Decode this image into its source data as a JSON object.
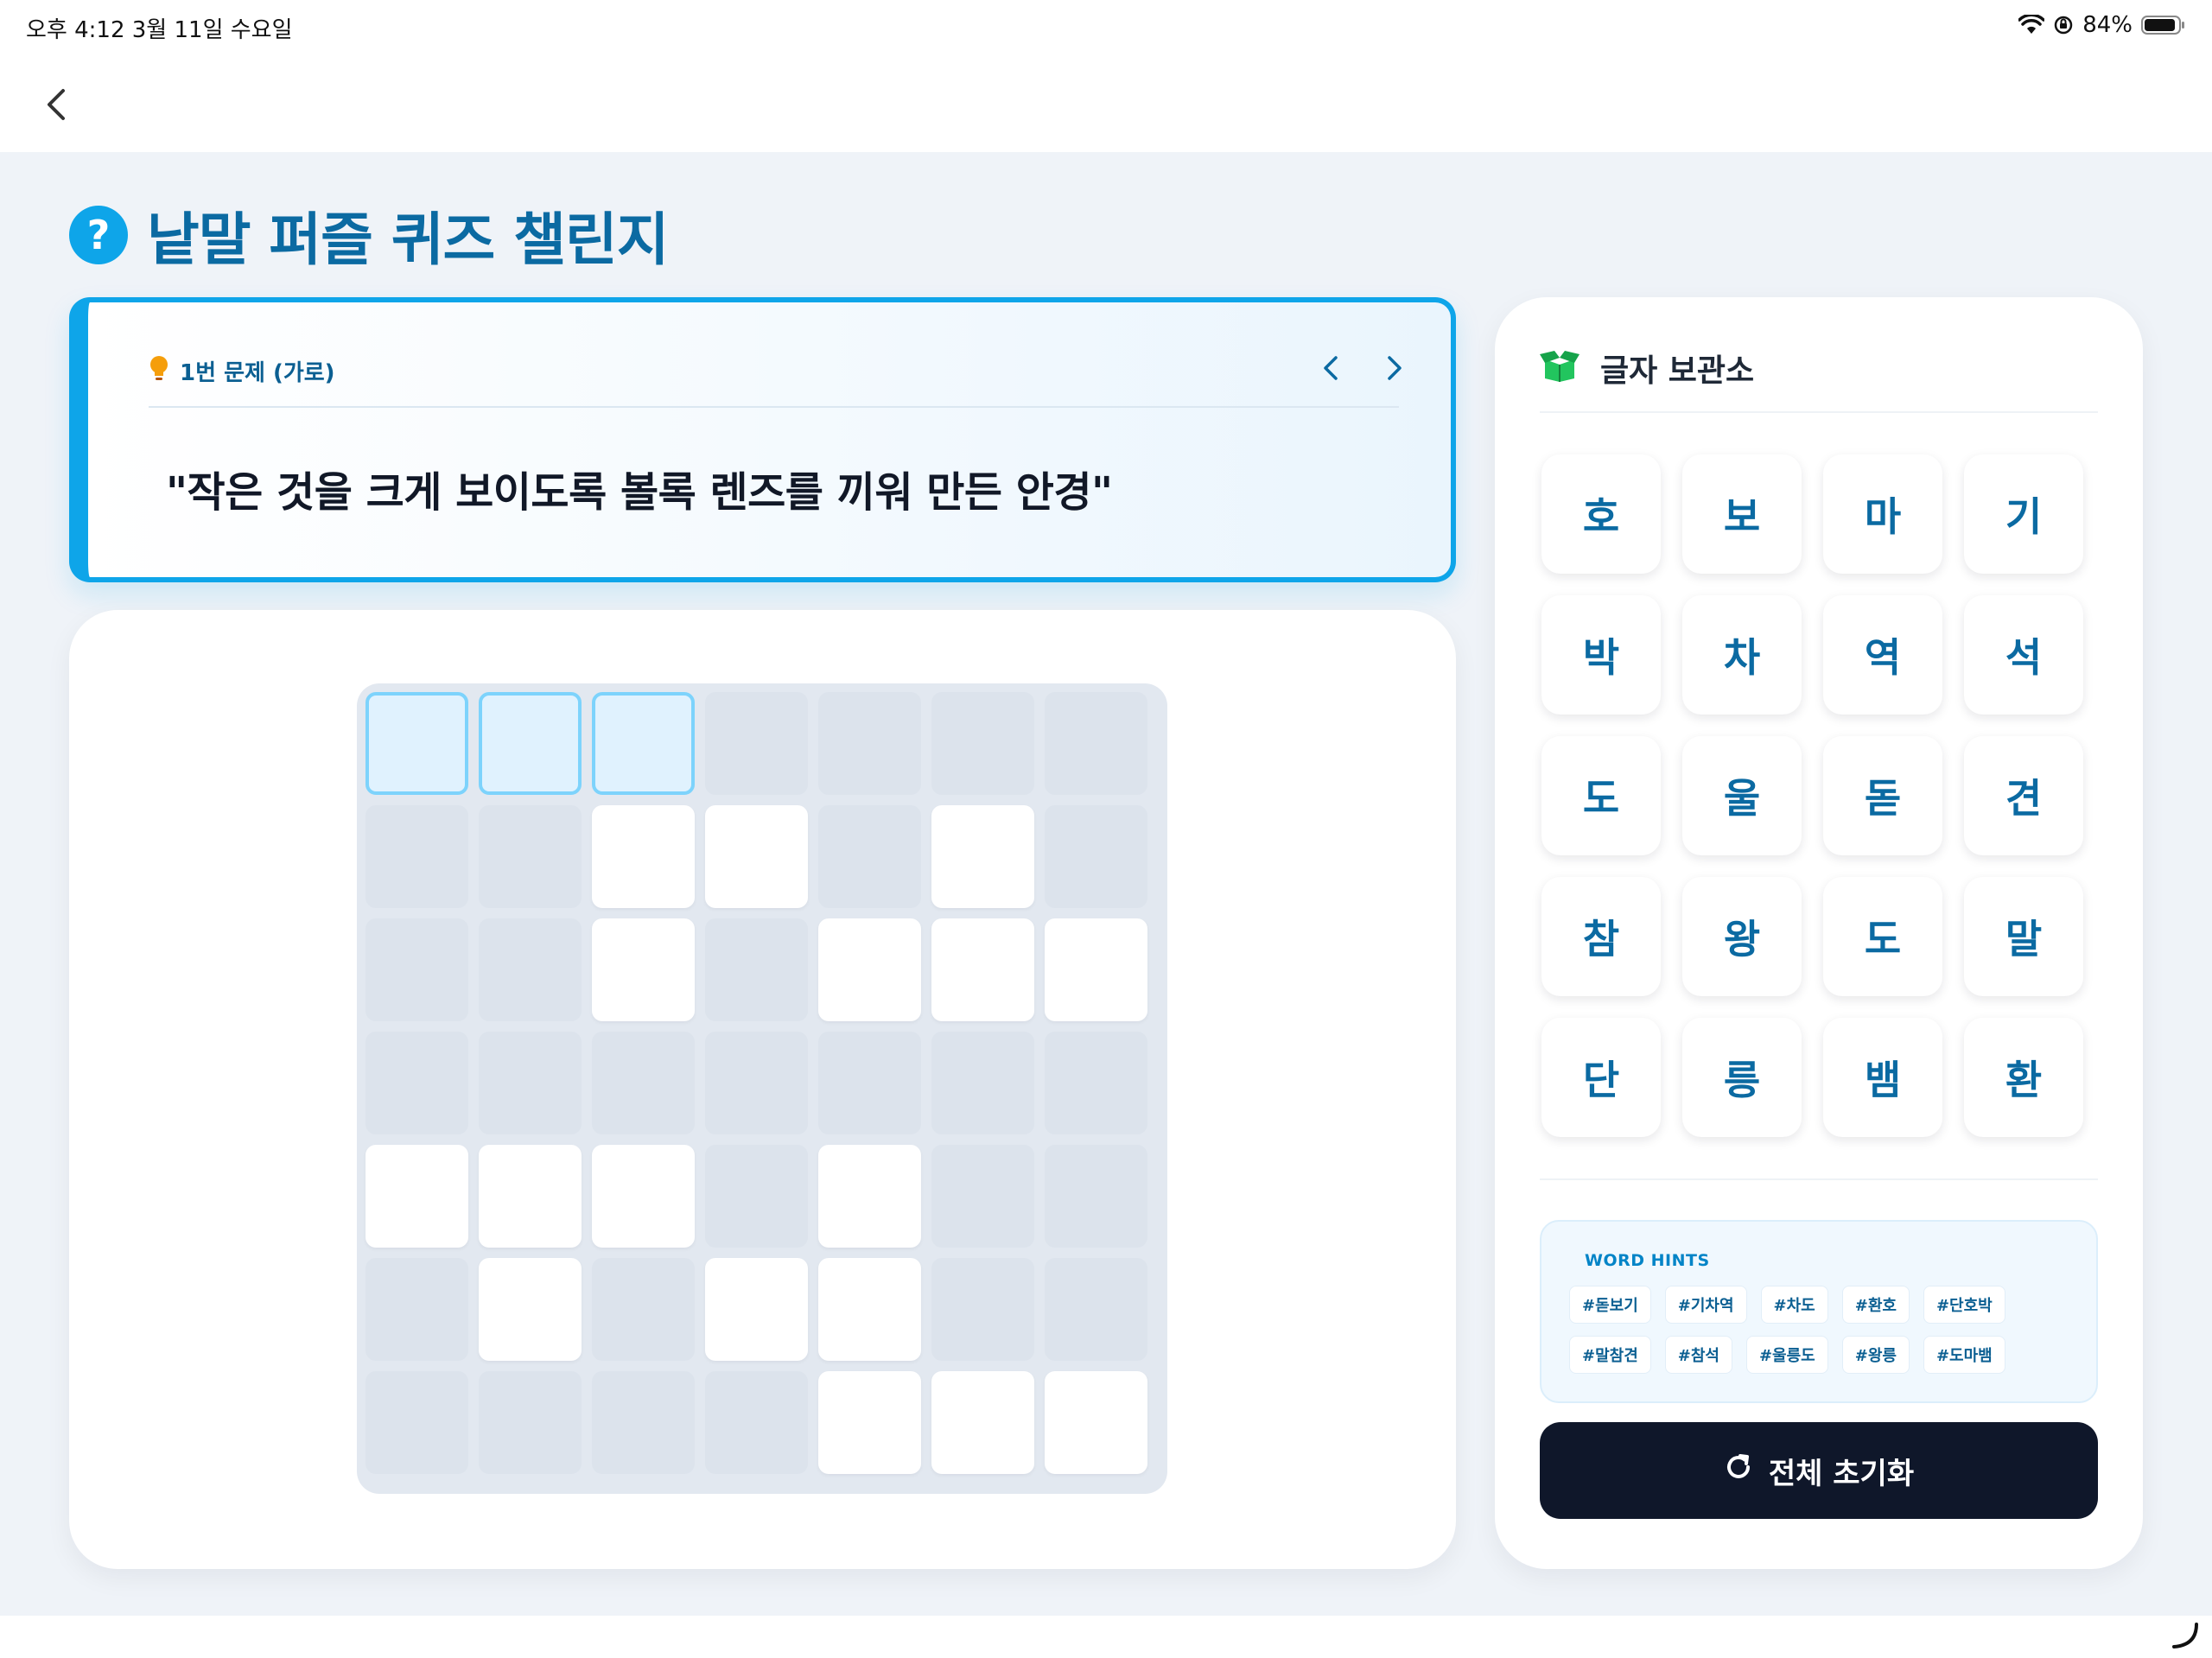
{
  "status_bar": {
    "time_date": "오후 4:12   3월 11일 수요일",
    "battery": "84%"
  },
  "page": {
    "title": "낱말 퍼즐 퀴즈 챌린지"
  },
  "question": {
    "label": "1번 문제 (가로)",
    "text": "\"작은 것을 크게 보이도록 볼록 렌즈를 끼워 만든 안경\""
  },
  "board": {
    "rows": 7,
    "cols": 7,
    "cells": [
      [
        "active",
        "active",
        "active",
        "blocked",
        "blocked",
        "blocked",
        "blocked"
      ],
      [
        "blocked",
        "blocked",
        "open",
        "open",
        "blocked",
        "open",
        "blocked"
      ],
      [
        "blocked",
        "blocked",
        "open",
        "blocked",
        "open",
        "open",
        "open"
      ],
      [
        "blocked",
        "blocked",
        "blocked",
        "blocked",
        "blocked",
        "blocked",
        "blocked"
      ],
      [
        "open",
        "open",
        "open",
        "blocked",
        "open",
        "blocked",
        "blocked"
      ],
      [
        "blocked",
        "open",
        "blocked",
        "open",
        "open",
        "blocked",
        "blocked"
      ],
      [
        "blocked",
        "blocked",
        "blocked",
        "blocked",
        "open",
        "open",
        "open"
      ]
    ]
  },
  "storage": {
    "title": "글자 보관소",
    "tiles": [
      "호",
      "보",
      "마",
      "기",
      "박",
      "차",
      "역",
      "석",
      "도",
      "울",
      "돋",
      "견",
      "참",
      "왕",
      "도",
      "말",
      "단",
      "릉",
      "뱀",
      "환"
    ]
  },
  "hints": {
    "title": "WORD HINTS",
    "row1": [
      "#돋보기",
      "#기차역",
      "#차도",
      "#환호",
      "#단호박"
    ],
    "row2": [
      "#말참견",
      "#참석",
      "#울릉도",
      "#왕릉",
      "#도마뱀"
    ]
  },
  "reset_label": "전체 초기화",
  "colors": {
    "accent": "#0ea5e9",
    "title": "#0b6aa2",
    "dark_button": "#0f172a",
    "background": "#eff3f8"
  }
}
